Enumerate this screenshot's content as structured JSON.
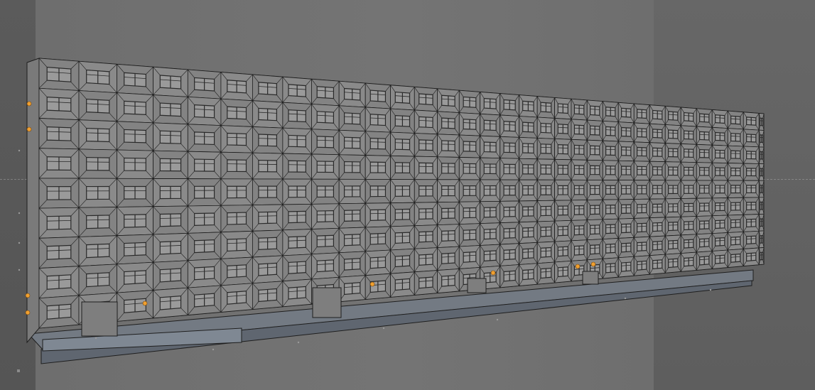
{
  "viewport": {
    "background": "#6e6e6e",
    "grid_line_color": "#b5b5b5"
  },
  "model": {
    "object": "apartment-block",
    "display_mode": "shaded-wireframe",
    "face_color": "#878787",
    "edge_color": "#1e1e1e",
    "window_color": "#2a2a2a",
    "base_color": "#7d8590",
    "point_color": "#f0a030",
    "floors": 9
  }
}
